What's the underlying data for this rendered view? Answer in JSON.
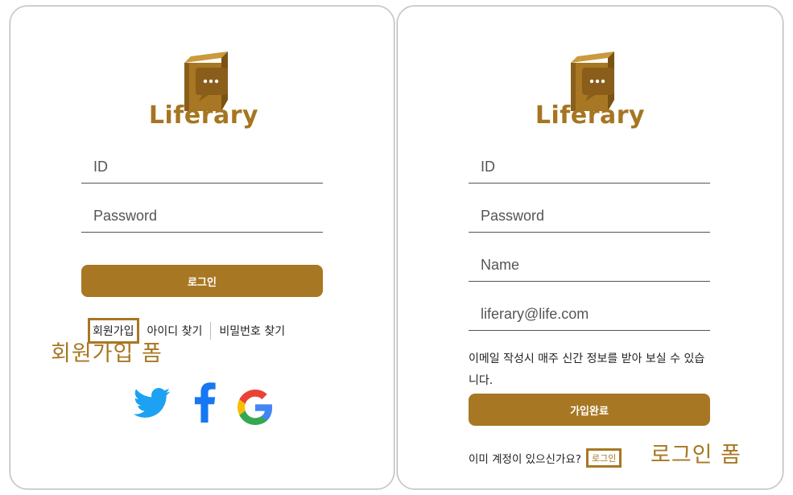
{
  "brand": {
    "name": "Liferary"
  },
  "login_form": {
    "id_placeholder": "ID",
    "password_placeholder": "Password",
    "login_button": "로그인",
    "links": {
      "signup": "회원가입",
      "find_id": "아이디 찾기",
      "find_password": "비밀번호 찾기"
    },
    "annotation": "회원가입 폼",
    "social": [
      "twitter-icon",
      "facebook-icon",
      "google-icon"
    ]
  },
  "signup_form": {
    "id_placeholder": "ID",
    "password_placeholder": "Password",
    "name_placeholder": "Name",
    "email_placeholder": "liferary@life.com",
    "info_text": "이메일 작성시 매주 신간 정보를 받아 보실 수 있습니다.",
    "submit_button": "가입완료",
    "existing_prompt": "이미 계정이 있으신가요?",
    "login_link": "로그인",
    "annotation": "로그인 폼"
  },
  "colors": {
    "accent": "#a87723",
    "twitter": "#1da1f2",
    "facebook": "#1877f2"
  }
}
